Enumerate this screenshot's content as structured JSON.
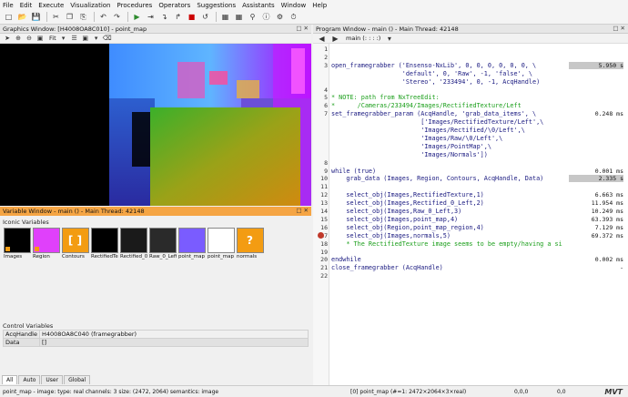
{
  "menu": [
    "File",
    "Edit",
    "Execute",
    "Visualization",
    "Procedures",
    "Operators",
    "Suggestions",
    "Assistants",
    "Window",
    "Help"
  ],
  "graphics_window": {
    "title": "Graphics Window: [H4008OA8C010] - point_map",
    "zoom": "Fit"
  },
  "variable_window": {
    "title": "Variable Window - main () - Main Thread: 42148",
    "iconic_label": "Iconic Variables",
    "iconic": [
      {
        "name": "Images",
        "color": "#000000"
      },
      {
        "name": "Region",
        "color": "#e040fb"
      },
      {
        "name": "Contours",
        "color": "#f39c12",
        "glyph": "[ ]"
      },
      {
        "name": "RectifiedTe",
        "color": "#000000"
      },
      {
        "name": "Rectified_0",
        "color": "#1a1a1a"
      },
      {
        "name": "Raw_0_Left",
        "color": "#2a2a2a"
      },
      {
        "name": "point_map",
        "color": "#7a5cff"
      },
      {
        "name": "point_map",
        "color": "#ffffff"
      },
      {
        "name": "normals",
        "color": "#f39c12",
        "glyph": "?"
      }
    ],
    "control_label": "Control Variables",
    "controls": [
      {
        "key": "AcqHandle",
        "value": "H4008OA8C040 (framegrabber)"
      },
      {
        "key": "Data",
        "value": "[]"
      }
    ],
    "tabs": [
      "All",
      "Auto",
      "User",
      "Global"
    ]
  },
  "program_window": {
    "title": "Program Window - main () - Main Thread: 42148",
    "procedure": "main (: : : :)",
    "lines": [
      {
        "n": "1",
        "code": "",
        "time": ""
      },
      {
        "n": "2",
        "code": "",
        "time": ""
      },
      {
        "n": "3",
        "code": "open_framegrabber ('Ensenso-NxLib', 0, 0, 0, 0, 0, 0, \\",
        "time": "5.950  s",
        "hl": true
      },
      {
        "n": "",
        "code": "                   'default', 0, 'Raw', -1, 'false', \\",
        "time": ""
      },
      {
        "n": "",
        "code": "                   'Stereo', '233494', 0, -1, AcqHandle)",
        "time": ""
      },
      {
        "n": "4",
        "code": "",
        "time": ""
      },
      {
        "n": "5",
        "code": "* NOTE: path from NxTreeEdit:",
        "time": "",
        "comment": true
      },
      {
        "n": "6",
        "code": "*      /Cameras/233494/Images/RectifiedTexture/Left",
        "time": "",
        "comment": true
      },
      {
        "n": "7",
        "code": "set_framegrabber_param (AcqHandle, 'grab_data_items', \\",
        "time": "0.248 ms"
      },
      {
        "n": "",
        "code": "                        ['Images/RectifiedTexture/Left',\\",
        "time": ""
      },
      {
        "n": "",
        "code": "                        'Images/Rectified/\\0/Left',\\",
        "time": ""
      },
      {
        "n": "",
        "code": "                        'Images/Raw/\\0/Left',\\",
        "time": ""
      },
      {
        "n": "",
        "code": "                        'Images/PointMap',\\",
        "time": ""
      },
      {
        "n": "",
        "code": "                        'Images/Normals'])",
        "time": ""
      },
      {
        "n": "8",
        "code": "",
        "time": ""
      },
      {
        "n": "9",
        "code": "while (true)",
        "time": "0.001 ms"
      },
      {
        "n": "10",
        "code": "    grab_data (Images, Region, Contours, AcqHandle, Data)",
        "time": "2.335  s",
        "hl": true
      },
      {
        "n": "11",
        "code": "",
        "time": ""
      },
      {
        "n": "12",
        "code": "    select_obj(Images,RectifiedTexture,1)",
        "time": "6.663 ms"
      },
      {
        "n": "13",
        "code": "    select_obj(Images,Rectified_0_Left,2)",
        "time": "11.954 ms"
      },
      {
        "n": "14",
        "code": "    select_obj(Images,Raw_0_Left,3)",
        "time": "10.249 ms"
      },
      {
        "n": "15",
        "code": "    select_obj(Images,point_map,4)",
        "time": "63.393 ms"
      },
      {
        "n": "16",
        "code": "    select_obj(Region,point_map_region,4)",
        "time": "7.129 ms"
      },
      {
        "n": "17",
        "code": "    select_obj(Images,normals,5)",
        "time": "69.372 ms",
        "bp": true
      },
      {
        "n": "18",
        "code": "    * The RectifiedTexture image seems to be empty/having a si",
        "time": "",
        "comment": true
      },
      {
        "n": "19",
        "code": "",
        "time": ""
      },
      {
        "n": "20",
        "code": "endwhile",
        "time": "0.002 ms"
      },
      {
        "n": "21",
        "code": "close_framegrabber (AcqHandle)",
        "time": "-"
      },
      {
        "n": "22",
        "code": "",
        "time": ""
      }
    ]
  },
  "status": {
    "left": "point_map - image: type: real channels: 3 size: (2472, 2064) semantics: image",
    "middle": "[0] point_map (#=1: 2472×2064×3×real)",
    "coord1": "0,0,0",
    "coord2": "0,0",
    "logo": "MVT"
  }
}
